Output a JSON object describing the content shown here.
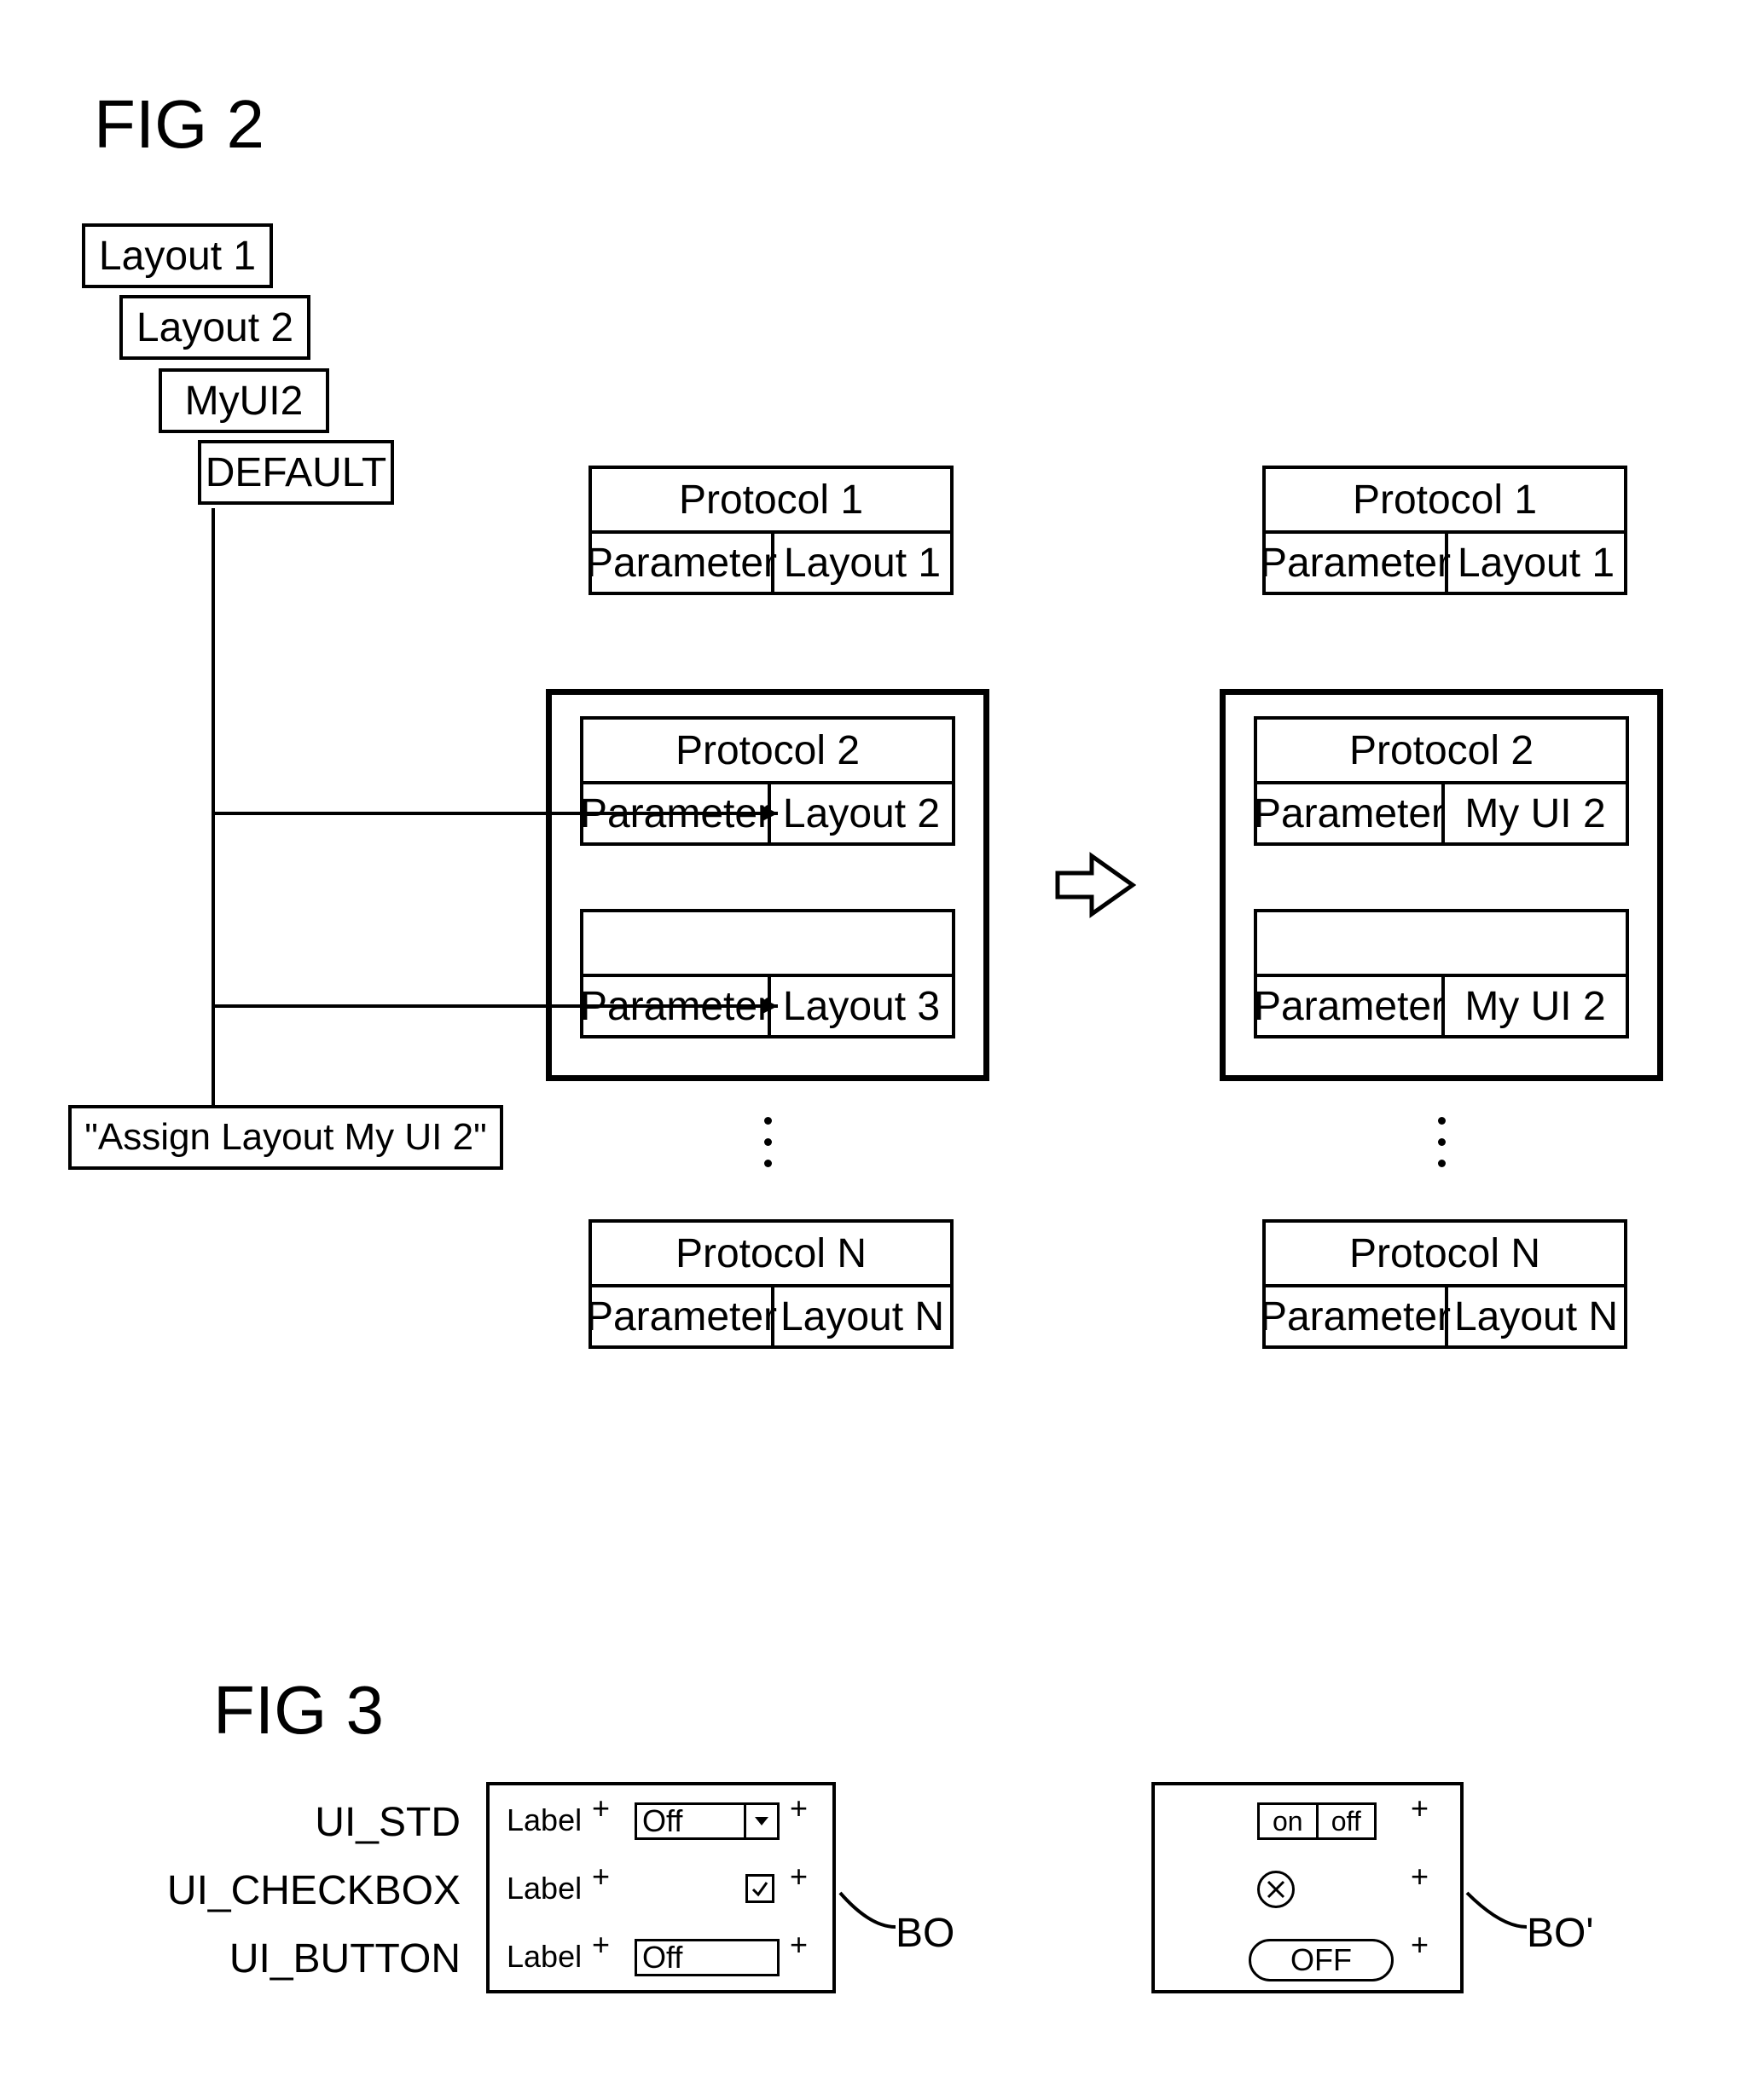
{
  "fig2": {
    "title": "FIG 2",
    "layouts": [
      "Layout 1",
      "Layout 2",
      "MyUI2",
      "DEFAULT"
    ],
    "assign_label": "\"Assign Layout My UI 2\"",
    "left_col": {
      "p1": {
        "title": "Protocol 1",
        "param": "Parameter",
        "layout": "Layout 1"
      },
      "p2": {
        "title": "Protocol 2",
        "r1": {
          "param": "Parameter",
          "layout": "Layout 2"
        },
        "r2": {
          "param": "Parameter",
          "layout": "Layout 3"
        }
      },
      "pN": {
        "title": "Protocol N",
        "param": "Parameter",
        "layout": "Layout N"
      }
    },
    "right_col": {
      "p1": {
        "title": "Protocol 1",
        "param": "Parameter",
        "layout": "Layout 1"
      },
      "p2": {
        "title": "Protocol 2",
        "r1": {
          "param": "Parameter",
          "layout": "My UI 2"
        },
        "r2": {
          "param": "Parameter",
          "layout": "My UI 2"
        }
      },
      "pN": {
        "title": "Protocol N",
        "param": "Parameter",
        "layout": "Layout N"
      }
    }
  },
  "fig3": {
    "title": "FIG 3",
    "row_labels": [
      "UI_STD",
      "UI_CHECKBOX",
      "UI_BUTTON"
    ],
    "left_panel": {
      "label": "Label",
      "dropdown_value": "Off",
      "button_value": "Off"
    },
    "right_panel": {
      "toggle_on": "on",
      "toggle_off": "off",
      "button_value": "OFF"
    },
    "callouts": {
      "left": "BO",
      "right": "BO'"
    }
  }
}
